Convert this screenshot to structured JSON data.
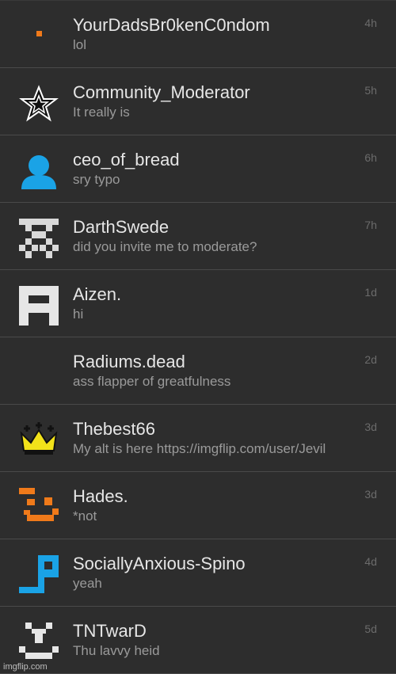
{
  "conversations": [
    {
      "name": "YourDadsBr0kenC0ndom",
      "message": "lol",
      "time": "4h",
      "avatar_icon": "orange-dot-icon"
    },
    {
      "name": "Community_Moderator",
      "message": "It really is",
      "time": "5h",
      "avatar_icon": "star-badge-icon"
    },
    {
      "name": "ceo_of_bread",
      "message": "sry typo",
      "time": "6h",
      "avatar_icon": "default-user-icon"
    },
    {
      "name": "DarthSwede",
      "message": "did you invite me to moderate?",
      "time": "7h",
      "avatar_icon": "pixel-checker-icon"
    },
    {
      "name": "Aizen.",
      "message": "hi",
      "time": "1d",
      "avatar_icon": "pixel-a-icon"
    },
    {
      "name": "Radiums.dead",
      "message": "ass flapper of greatfulness",
      "time": "2d",
      "avatar_icon": "blank-avatar"
    },
    {
      "name": "Thebest66",
      "message": "My alt is here https://imgflip.com/user/Jevil",
      "time": "3d",
      "avatar_icon": "crown-icon"
    },
    {
      "name": "Hades.",
      "message": "*not",
      "time": "3d",
      "avatar_icon": "pixel-face-orange-icon"
    },
    {
      "name": "SociallyAnxious-Spino",
      "message": "yeah",
      "time": "4d",
      "avatar_icon": "pixel-p-blue-icon"
    },
    {
      "name": "TNTwarD",
      "message": "Thu lavvy heid",
      "time": "5d",
      "avatar_icon": "pixel-smile-white-icon"
    }
  ],
  "watermark": "imgflip.com",
  "colors": {
    "background": "#2b2b2b",
    "name_text": "#e6e6e6",
    "message_text": "#9a9a9a",
    "time_text": "#6b6b6b",
    "orange": "#f07a1a",
    "blue": "#1aa3e6",
    "yellow": "#f2e21a"
  }
}
